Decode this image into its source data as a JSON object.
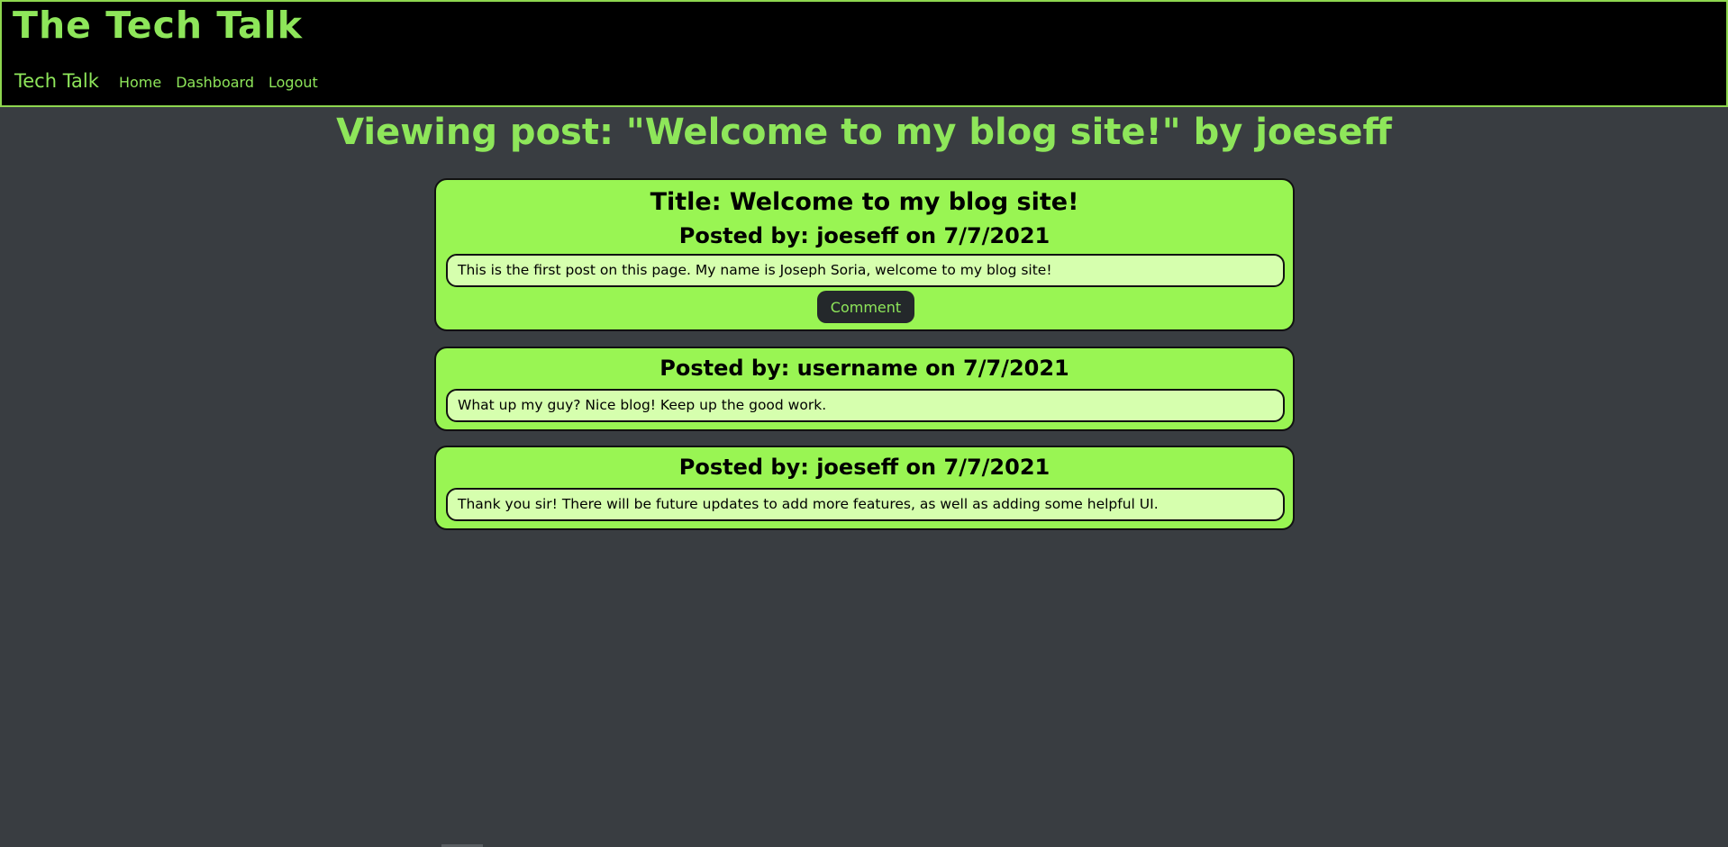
{
  "header": {
    "site_title": "The Tech Talk",
    "nav_brand": "Tech Talk",
    "nav_links": [
      "Home",
      "Dashboard",
      "Logout"
    ]
  },
  "page": {
    "heading": "Viewing post: \"Welcome to my blog site!\" by joeseff"
  },
  "post": {
    "title": "Title: Welcome to my blog site!",
    "meta": "Posted by: joeseff on 7/7/2021",
    "content": "This is the first post on this page. My name is Joseph Soria, welcome to my blog site!",
    "comment_button": "Comment"
  },
  "comments": [
    {
      "meta": "Posted by: username on 7/7/2021",
      "content": "What up my guy? Nice blog! Keep up the good work."
    },
    {
      "meta": "Posted by: joeseff on 7/7/2021",
      "content": "Thank you sir! There will be future updates to add more features, as well as adding some helpful UI."
    }
  ],
  "colors": {
    "accent": "#8ee65a",
    "card_bg": "#99f553",
    "card_body_bg": "#d6ffae",
    "page_bg": "#393d41",
    "header_bg": "#000000",
    "button_bg": "#24282b"
  }
}
